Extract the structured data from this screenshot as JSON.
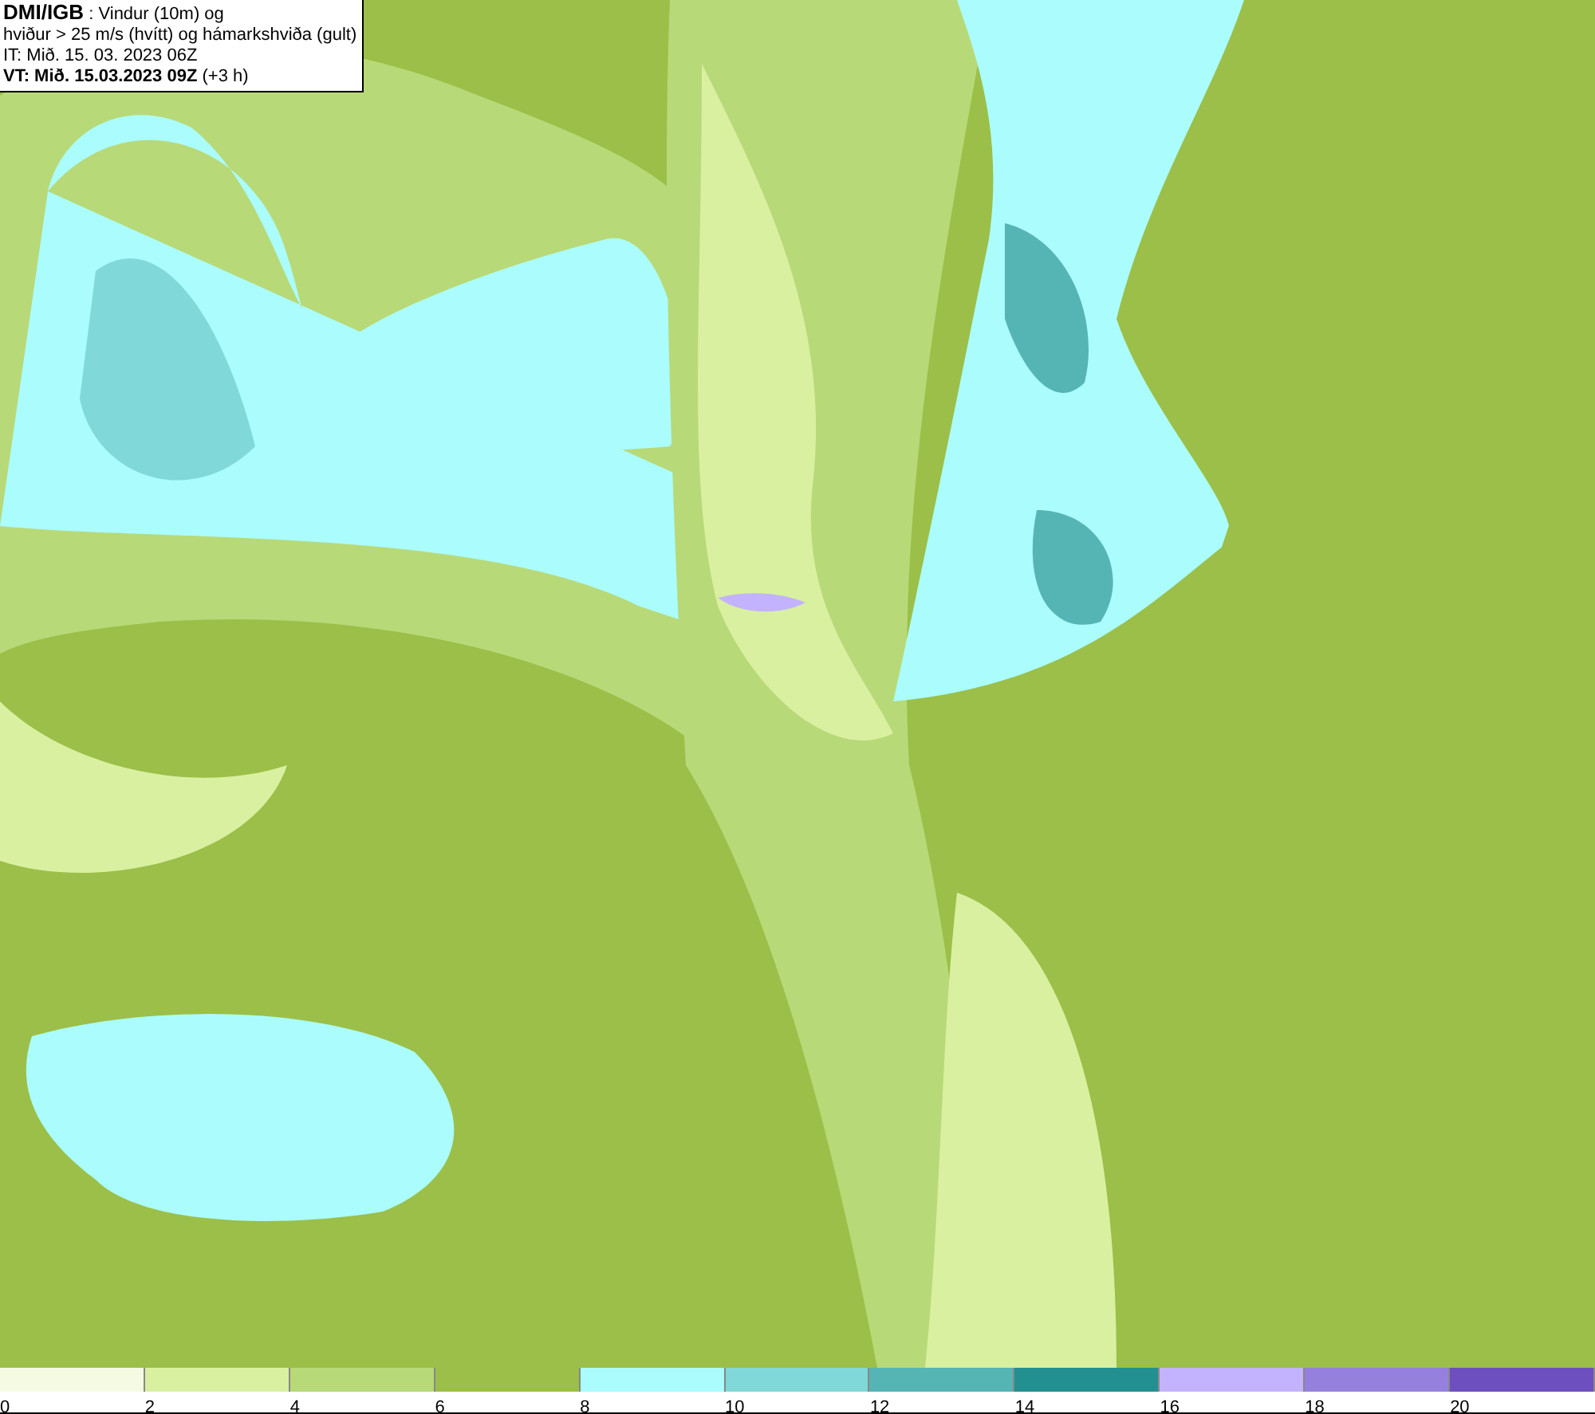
{
  "info_box": {
    "lines": [
      "**DMI/IGB** : Vindur (10m) og",
      "hviður > 25 m/s (hvítt) og hámarkshviða (gult)",
      "IT: Mið. 15. 03. 2023 06Z",
      "**VT: Mið. 15.03.2023 09Z** (+3 h)"
    ]
  },
  "legend": {
    "segments": [
      {
        "label": "0",
        "color": "#f5fbe3"
      },
      {
        "label": "2",
        "color": "#d9f0a0"
      },
      {
        "label": "4",
        "color": "#b8d978"
      },
      {
        "label": "6",
        "color": "#9bbf48"
      },
      {
        "label": "8",
        "color": "#abfcfc"
      },
      {
        "label": "10",
        "color": "#80d8d8"
      },
      {
        "label": "12",
        "color": "#55b5b5"
      },
      {
        "label": "14",
        "color": "#229090"
      },
      {
        "label": "16",
        "color": "#c3b3ff"
      },
      {
        "label": "18",
        "color": "#9580de"
      },
      {
        "label": "20",
        "color": "#6e4fbf"
      }
    ]
  }
}
